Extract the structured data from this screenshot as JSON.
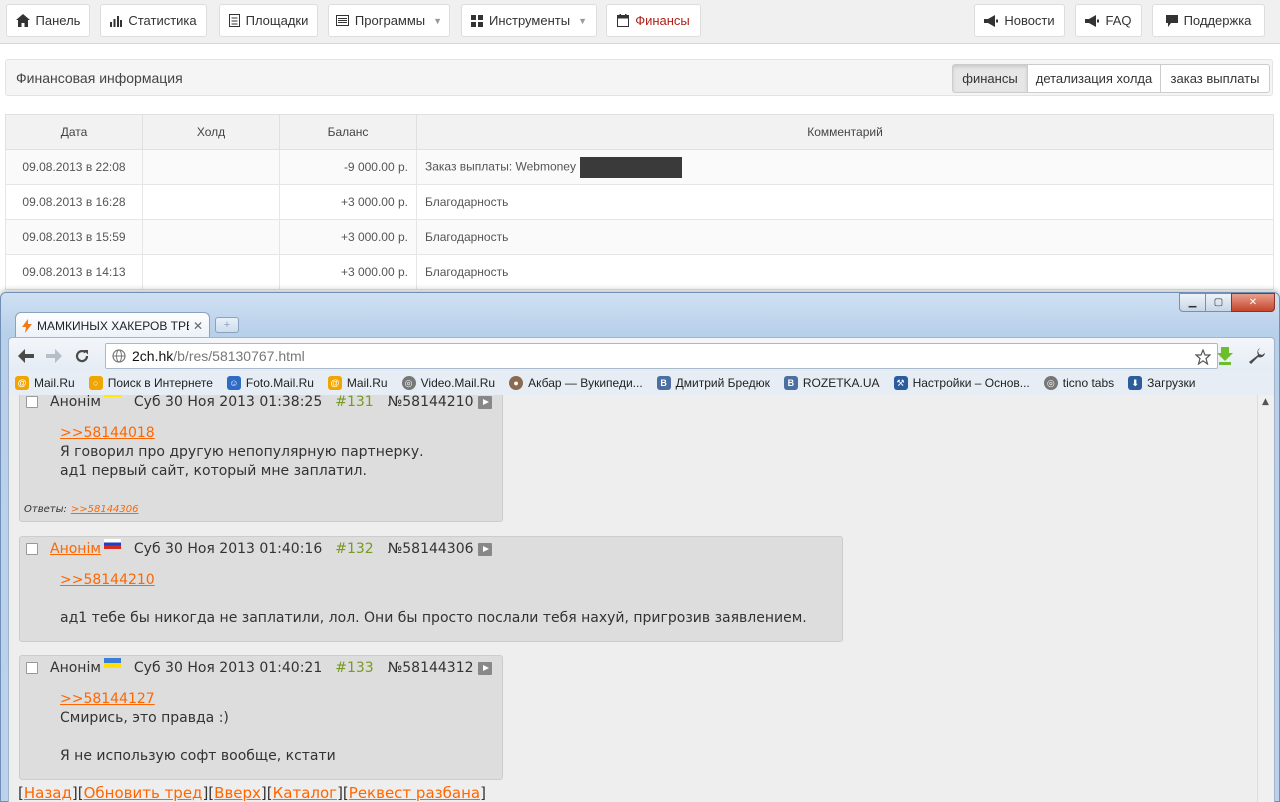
{
  "nav": {
    "panel": "Панель",
    "stats": "Статистика",
    "sites": "Площадки",
    "programs": "Программы",
    "tools": "Инструменты",
    "finance": "Финансы",
    "news": "Новости",
    "faq": "FAQ",
    "support": "Поддержка"
  },
  "finance": {
    "title": "Финансовая информация",
    "tabs": [
      "финансы",
      "детализация холда",
      "заказ выплаты"
    ],
    "columns": [
      "Дата",
      "Холд",
      "Баланс",
      "Комментарий"
    ],
    "rows": [
      {
        "date": "09.08.2013 в 22:08",
        "hold": "",
        "balance": "-9 000.00 р.",
        "comment": "Заказ выплаты: Webmoney"
      },
      {
        "date": "09.08.2013 в 16:28",
        "hold": "",
        "balance": "+3 000.00 р.",
        "comment": "Благодарность"
      },
      {
        "date": "09.08.2013 в 15:59",
        "hold": "",
        "balance": "+3 000.00 р.",
        "comment": "Благодарность"
      },
      {
        "date": "09.08.2013 в 14:13",
        "hold": "",
        "balance": "+3 000.00 р.",
        "comment": "Благодарность"
      }
    ],
    "colors": {
      "negative": "#b3201b",
      "positive": "#2a8a2a"
    }
  },
  "browser": {
    "tab_title": "МАМКИНЫХ ХАКЕРОВ ТРЕ",
    "url_domain": "2ch.hk",
    "url_path": "/b/res/58130767.html",
    "bookmarks": [
      "Mail.Ru",
      "Поиск в Интернете",
      "Foto.Mail.Ru",
      "Mail.Ru",
      "Video.Mail.Ru",
      "Акбар — Вукипеди...",
      "Дмитрий Бредюк",
      "ROZETKA.UA",
      "Настройки – Основ...",
      "ticno tabs",
      "Загрузки"
    ]
  },
  "thread": {
    "posts": [
      {
        "name": "Анонім",
        "date": "Суб 30 Ноя 2013 01:38:25",
        "num": "#131",
        "id": "№58144210",
        "ref": ">>58144018",
        "lines": [
          "Я говорил про другую непопулярную партнерку.",
          "ад1 первый сайт, который мне заплатил."
        ],
        "replies_label": "Ответы:",
        "replies": [
          ">>58144306"
        ]
      },
      {
        "name": "Анонім",
        "date": "Суб 30 Ноя 2013 01:40:16",
        "num": "#132",
        "id": "№58144306",
        "ref": ">>58144210",
        "lines": [
          "ад1 тебе бы никогда не заплатили, лол. Они бы просто послали тебя нахуй, пригрозив заявлением."
        ]
      },
      {
        "name": "Анонім",
        "date": "Суб 30 Ноя 2013 01:40:21",
        "num": "#133",
        "id": "№58144312",
        "ref": ">>58144127",
        "lines": [
          "Смирись, это правда :)",
          "Я не использую софт вообще, кстати"
        ]
      }
    ],
    "bottom_links": [
      "Назад",
      "Обновить тред",
      "Вверх",
      "Каталог",
      "Реквест разбана"
    ],
    "colors": {
      "link": "#ff6600",
      "postnum": "#789922"
    }
  }
}
